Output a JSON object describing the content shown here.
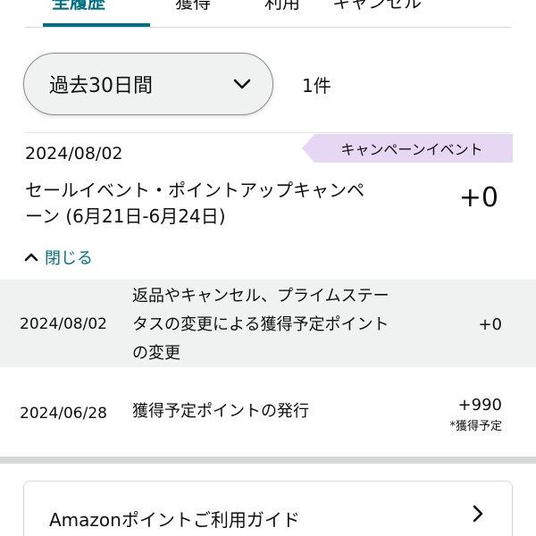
{
  "tabs": [
    {
      "label": "全履歴",
      "active": true
    },
    {
      "label": "獲得",
      "active": false
    },
    {
      "label": "利用",
      "active": false
    },
    {
      "label": "キャンセル",
      "active": false
    }
  ],
  "filter": {
    "period": "過去30日間",
    "count": "1件"
  },
  "entry": {
    "date": "2024/08/02",
    "badge": "キャンペーンイベント",
    "title": "セールイベント・ポイントアップキャンペーン (6月21日-6月24日)",
    "points": "+0",
    "collapse_label": "閉じる"
  },
  "details": [
    {
      "date": "2024/08/02",
      "description": "返品やキャンセル、プライムステータスの変更による獲得予定ポイントの変更",
      "points": "+0",
      "note": ""
    },
    {
      "date": "2024/06/28",
      "description": "獲得予定ポイントの発行",
      "points": "+990",
      "note": "*獲得予定"
    }
  ],
  "guide": {
    "label": "Amazonポイントご利用ガイド"
  },
  "colors": {
    "accent": "#007185",
    "badge_bg": "#e6d7f5",
    "row_alt_bg": "#f0f2f2",
    "divider": "#d5d9d9"
  },
  "icons": {
    "period_select": "chevron-down-icon",
    "collapse": "chevron-up-icon",
    "guide": "chevron-right-icon"
  }
}
